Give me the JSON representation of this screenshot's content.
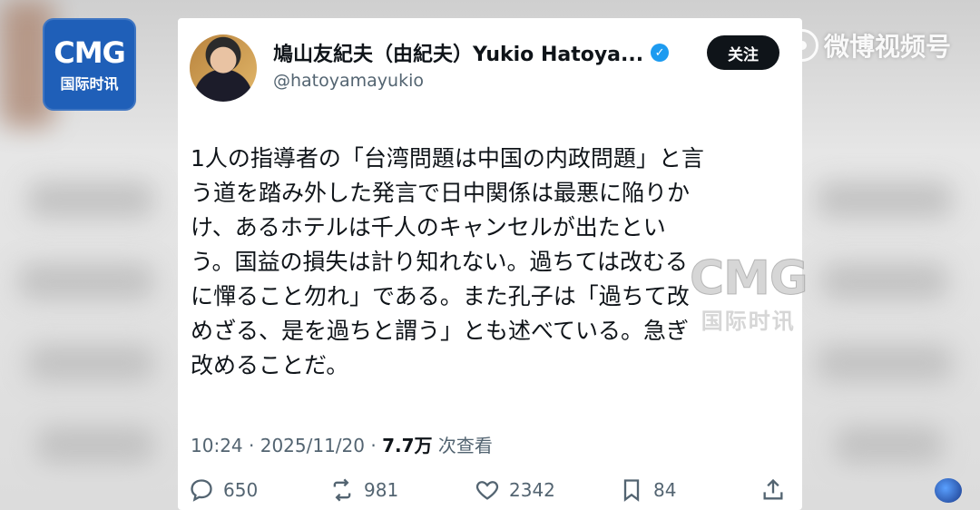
{
  "logo": {
    "big": "CMG",
    "small": "国际时讯"
  },
  "user": {
    "display_name": "鳩山友紀夫（由紀夫）Yukio Hatoya...",
    "handle": "@hatoyamayukio",
    "verified_mark": "✓",
    "follow_label": "关注"
  },
  "tweet": {
    "text": "1人の指導者の「台湾問題は中国の内政問題」と言\nう道を踏み外した発言で日中関係は最悪に陥りか\nけ、あるホテルは千人のキャンセルが出たとい\nう。国益の損失は計り知れない。過ちては改むる\nに憚ること勿れ」である。また孔子は「過ちて改\nめざる、是を過ちと謂う」とも述べている。急ぎ\n改めることだ。",
    "time": "10:24",
    "dot": "·",
    "date": "2025/11/20",
    "views": "7.7万",
    "views_suffix": "次查看"
  },
  "actions": {
    "reply": {
      "icon": "reply-icon",
      "count": "650"
    },
    "retweet": {
      "icon": "retweet-icon",
      "count": "981"
    },
    "like": {
      "icon": "heart-icon",
      "count": "2342"
    },
    "bookmark": {
      "icon": "bookmark-icon",
      "count": "84"
    },
    "share": {
      "icon": "share-icon"
    }
  },
  "watermarks": {
    "weibo": "微博视频号",
    "cmg_big": "CMG",
    "cmg_small": "国际时讯"
  },
  "colors": {
    "logo_bg": "#1f5fb8",
    "verified": "#1d9bf0",
    "follow_bg": "#0f1419",
    "text": "#0f1419",
    "muted": "#536471"
  }
}
